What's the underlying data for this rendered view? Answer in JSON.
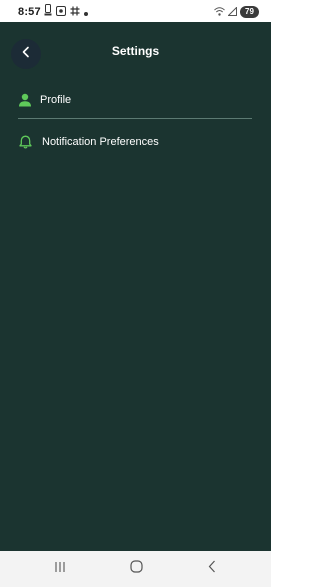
{
  "status_bar": {
    "time": "8:57",
    "battery": "79",
    "left_icons": [
      "notification-icon",
      "slack-icon",
      "hash-icon",
      "dot-icon"
    ],
    "right_icons": [
      "wifi-icon",
      "signal-icon"
    ]
  },
  "header": {
    "title": "Settings",
    "back_icon": "chevron-left-icon"
  },
  "menu": {
    "items": [
      {
        "label": "Profile",
        "icon": "person-icon"
      },
      {
        "label": "Notification Preferences",
        "icon": "bell-icon"
      }
    ]
  },
  "nav_bar": {
    "buttons": [
      "recent-apps-icon",
      "home-icon",
      "back-icon"
    ]
  },
  "colors": {
    "background": "#1b3430",
    "accent": "#5fc95a",
    "text": "#ffffff",
    "back_button_bg": "#1c2b36"
  }
}
